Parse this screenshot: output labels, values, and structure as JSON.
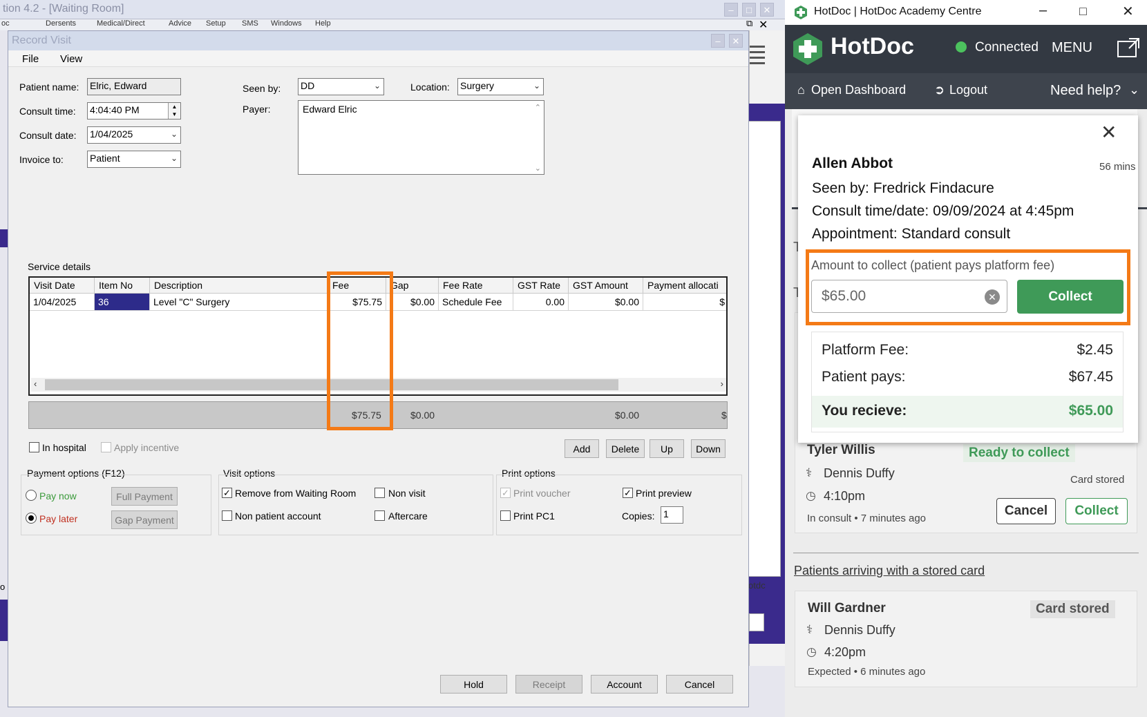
{
  "bg_window": {
    "title": "tion 4.2 - [Waiting Room]",
    "menu": [
      "oc",
      "Dersents",
      "Medical/Direct",
      "Advice",
      "Setup",
      "SMS",
      "Windows",
      "Help"
    ],
    "side_text_1": "o",
    "side_text_2": "otdc"
  },
  "record_visit": {
    "title": "Record Visit",
    "menu": {
      "file": "File",
      "view": "View"
    },
    "patient_name_label": "Patient name:",
    "patient_name": "Elric, Edward",
    "consult_time_label": "Consult time:",
    "consult_time": "4:04:40 PM",
    "consult_date_label": "Consult date:",
    "consult_date": "1/04/2025",
    "invoice_to_label": "Invoice to:",
    "invoice_to": "Patient",
    "seen_by_label": "Seen by:",
    "seen_by": "DD",
    "location_label": "Location:",
    "location": "Surgery",
    "payer_label": "Payer:",
    "payer": "Edward Elric",
    "service_details_label": "Service details",
    "columns": [
      "Visit Date",
      "Item No",
      "Description",
      "Fee",
      "Gap",
      "Fee Rate",
      "GST Rate",
      "GST Amount",
      "Payment allocati"
    ],
    "row": {
      "visit_date": "1/04/2025",
      "item_no": "36",
      "description": "Level \"C\" Surgery",
      "fee": "$75.75",
      "gap": "$0.00",
      "fee_rate": "Schedule Fee",
      "gst_rate": "0.00",
      "gst_amount": "$0.00",
      "payment_allocation": "$"
    },
    "totals": {
      "fee": "$75.75",
      "gap": "$0.00",
      "gst": "$0.00",
      "extra": "$"
    },
    "in_hospital": "In hospital",
    "apply_incentive": "Apply incentive",
    "buttons": {
      "add": "Add",
      "delete": "Delete",
      "up": "Up",
      "down": "Down"
    },
    "payment_options": {
      "title": "Payment options (F12)",
      "pay_now": "Pay now",
      "pay_later": "Pay later",
      "full_payment": "Full Payment",
      "gap_payment": "Gap Payment"
    },
    "visit_options": {
      "title": "Visit options",
      "remove_from_waiting_room": "Remove from Waiting Room",
      "non_visit": "Non visit",
      "non_patient_account": "Non patient account",
      "aftercare": "Aftercare"
    },
    "print_options": {
      "title": "Print options",
      "print_voucher": "Print voucher",
      "print_preview": "Print preview",
      "print_pc1": "Print PC1",
      "copies_label": "Copies:",
      "copies": "1"
    },
    "footer_buttons": {
      "hold": "Hold",
      "receipt": "Receipt",
      "account": "Account",
      "cancel": "Cancel"
    }
  },
  "hotdoc": {
    "window_title": "HotDoc | HotDoc Academy Centre",
    "brand": "HotDoc",
    "status": "Connected",
    "menu_label": "MENU",
    "nav": {
      "open_dashboard": "Open Dashboard",
      "logout": "Logout",
      "need_help": "Need help?"
    },
    "popup": {
      "patient_name": "Allen Abbot",
      "wait_time": "56 mins",
      "seen_by": "Seen by: Fredrick Findacure",
      "consult_time_date": "Consult time/date: 09/09/2024 at 4:45pm",
      "appointment": "Appointment: Standard consult",
      "amount_label": "Amount to collect (patient pays platform fee)",
      "amount_value": "$65.00",
      "collect_button": "Collect",
      "platform_fee_label": "Platform Fee:",
      "platform_fee": "$2.45",
      "patient_pays_label": "Patient pays:",
      "patient_pays": "$67.45",
      "you_receive_label": "You recieve:",
      "you_receive": "$65.00"
    },
    "card1": {
      "name": "Tyler Willis",
      "status": "Ready to collect",
      "doctor": "Dennis Duffy",
      "card_state": "Card stored",
      "time": "4:10pm",
      "note": "In consult • 7 minutes ago",
      "cancel": "Cancel",
      "collect": "Collect"
    },
    "stored_card_link": "Patients arriving with a stored card",
    "card2": {
      "name": "Will Gardner",
      "badge": "Card stored",
      "doctor": "Dennis Duffy",
      "time": "4:20pm",
      "note": "Expected • 6 minutes ago"
    },
    "partial_letters": [
      "T",
      "T"
    ],
    "colors": {
      "green": "#3f9a58",
      "header": "#333942",
      "highlight": "#f47a16"
    }
  }
}
